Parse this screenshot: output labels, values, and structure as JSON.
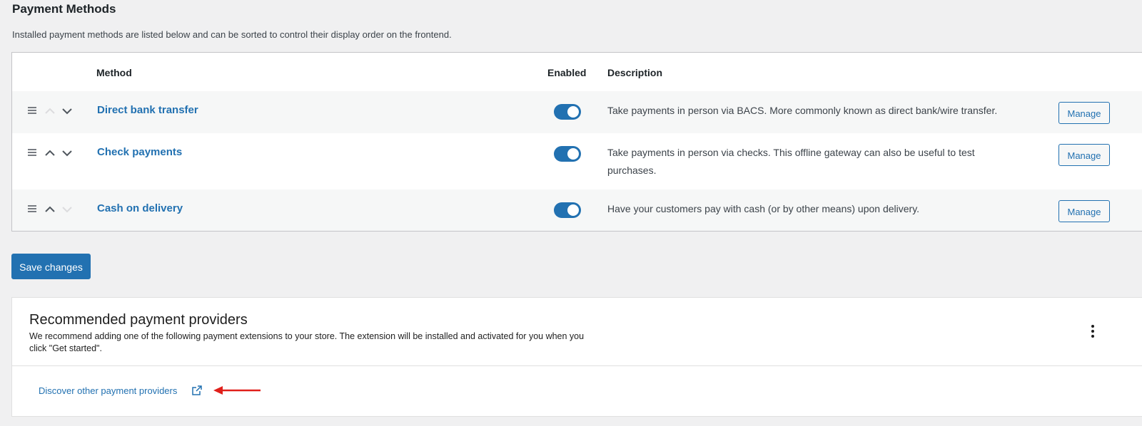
{
  "page": {
    "title": "Payment Methods",
    "description": "Installed payment methods are listed below and can be sorted to control their display order on the frontend."
  },
  "table": {
    "headers": {
      "method": "Method",
      "enabled": "Enabled",
      "description": "Description"
    },
    "rows": [
      {
        "name": "Direct bank transfer",
        "enabled": true,
        "description": "Take payments in person via BACS. More commonly known as direct bank/wire transfer.",
        "manage_label": "Manage",
        "can_move_up": false,
        "can_move_down": true
      },
      {
        "name": "Check payments",
        "enabled": true,
        "description": "Take payments in person via checks. This offline gateway can also be useful to test purchases.",
        "manage_label": "Manage",
        "can_move_up": true,
        "can_move_down": true
      },
      {
        "name": "Cash on delivery",
        "enabled": true,
        "description": "Have your customers pay with cash (or by other means) upon delivery.",
        "manage_label": "Manage",
        "can_move_up": true,
        "can_move_down": false
      }
    ]
  },
  "save_label": "Save changes",
  "recommended": {
    "title": "Recommended payment providers",
    "description": "We recommend adding one of the following payment extensions to your store. The extension will be installed and activated for you when you click \"Get started\".",
    "discover_label": "Discover other payment providers"
  },
  "icons": {
    "drag": "drag-handle-icon",
    "up": "chevron-up-icon",
    "down": "chevron-down-icon",
    "more": "more-vertical-icon",
    "external": "external-link-icon",
    "annotation": "red-arrow-icon"
  },
  "colors": {
    "accent": "#2271b1",
    "background": "#f0f0f1",
    "annotation_arrow": "#e0201b"
  }
}
